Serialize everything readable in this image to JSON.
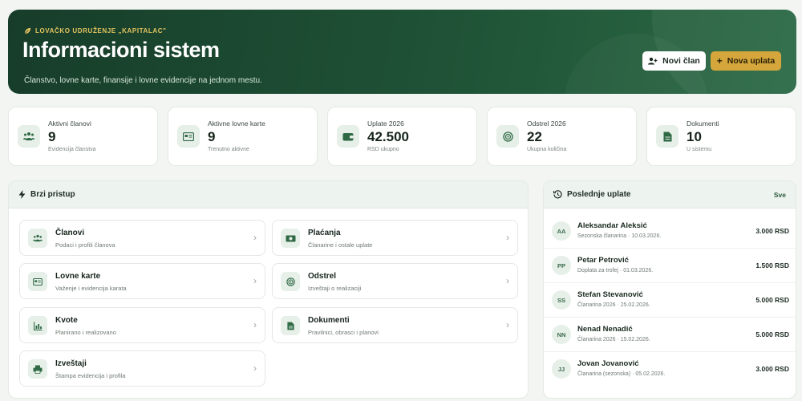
{
  "hero": {
    "org": "LOVAČKO UDRUŽENJE „KAPITALAC\"",
    "title": "Informacioni sistem",
    "subtitle": "Članstvo, lovne karte, finansije i lovne evidencije na jednom mestu.",
    "btn_new_member": "Novi član",
    "btn_new_payment": "Nova uplata",
    "colors": {
      "primary": "#1f5236",
      "accent": "#d4a63c"
    }
  },
  "stats": [
    {
      "label": "Aktivni članovi",
      "value": "9",
      "sub": "Evidencija članstva",
      "icon": "members-icon"
    },
    {
      "label": "Aktivne lovne karte",
      "value": "9",
      "sub": "Trenutno aktivne",
      "icon": "card-icon"
    },
    {
      "label": "Uplate 2026",
      "value": "42.500",
      "sub": "RSD ukupno",
      "icon": "wallet-icon"
    },
    {
      "label": "Odstrel 2026",
      "value": "22",
      "sub": "Ukupna količina",
      "icon": "target-icon"
    },
    {
      "label": "Dokumenti",
      "value": "10",
      "sub": "U sistemu",
      "icon": "document-icon"
    }
  ],
  "quick_access": {
    "title": "Brzi pristup",
    "items": [
      {
        "title": "Članovi",
        "sub": "Podaci i profili članova",
        "icon": "members-icon"
      },
      {
        "title": "Plaćanja",
        "sub": "Članarine i ostale uplate",
        "icon": "cash-icon"
      },
      {
        "title": "Lovne karte",
        "sub": "Važenje i evidencija karata",
        "icon": "card-icon"
      },
      {
        "title": "Odstrel",
        "sub": "Izveštaji o realizaciji",
        "icon": "target-icon"
      },
      {
        "title": "Kvote",
        "sub": "Planirano i realizovano",
        "icon": "chart-icon"
      },
      {
        "title": "Dokumenti",
        "sub": "Pravilnici, obrasci i planovi",
        "icon": "document-icon"
      },
      {
        "title": "Izveštaji",
        "sub": "Štampa evidencija i profila",
        "icon": "printer-icon"
      }
    ]
  },
  "recent_payments": {
    "title": "Poslednje uplate",
    "link": "Sve",
    "rows": [
      {
        "initials": "AA",
        "name": "Aleksandar Aleksić",
        "meta": "Sezonska članarina · 10.03.2026.",
        "amount": "3.000 RSD"
      },
      {
        "initials": "PP",
        "name": "Petar Petrović",
        "meta": "Doplata za trofej · 01.03.2026.",
        "amount": "1.500 RSD"
      },
      {
        "initials": "SS",
        "name": "Stefan Stevanović",
        "meta": "Članarina 2026 · 25.02.2026.",
        "amount": "5.000 RSD"
      },
      {
        "initials": "NN",
        "name": "Nenad Nenadić",
        "meta": "Članarina 2026 · 15.02.2026.",
        "amount": "5.000 RSD"
      },
      {
        "initials": "JJ",
        "name": "Jovan Jovanović",
        "meta": "Članarina (sezonska) · 05.02.2026.",
        "amount": "3.000 RSD"
      }
    ]
  }
}
